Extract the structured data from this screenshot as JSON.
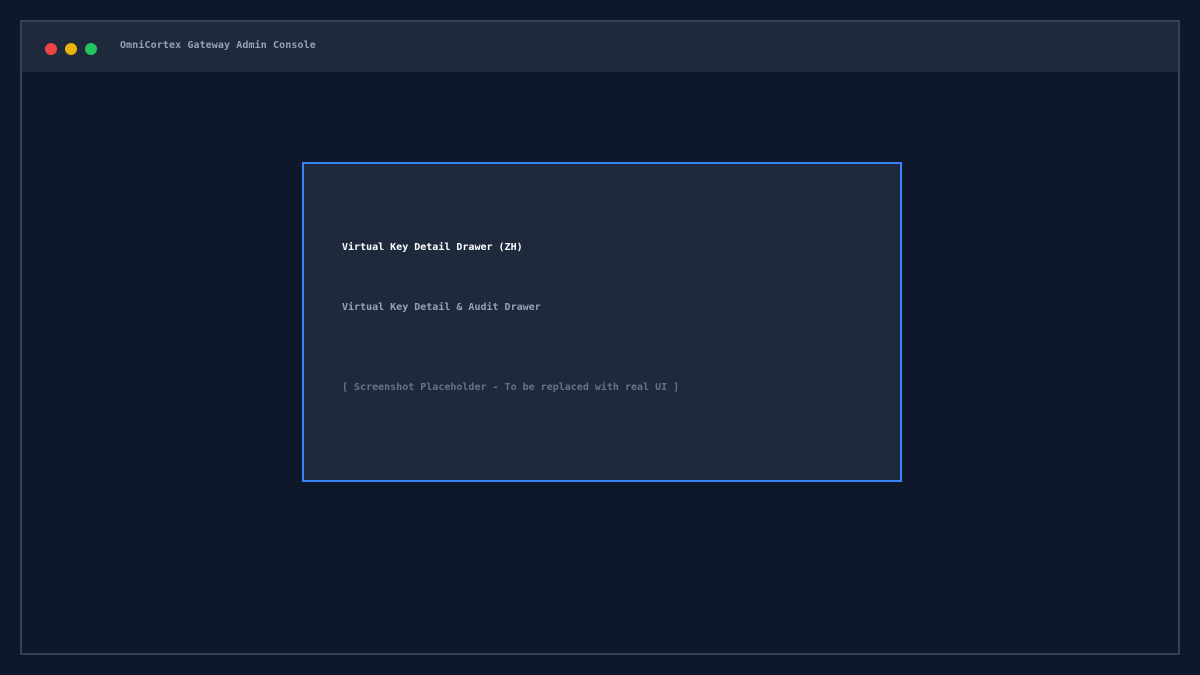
{
  "window": {
    "title": "OmniCortex Gateway Admin Console",
    "controls": {
      "close_color": "#ef4444",
      "minimize_color": "#eab308",
      "maximize_color": "#22c55e"
    }
  },
  "panel": {
    "title": "Virtual Key Detail Drawer (ZH)",
    "subtitle": "Virtual Key Detail & Audit Drawer",
    "placeholder": "[ Screenshot Placeholder - To be replaced with real UI ]",
    "border_color": "#3b82f6"
  }
}
